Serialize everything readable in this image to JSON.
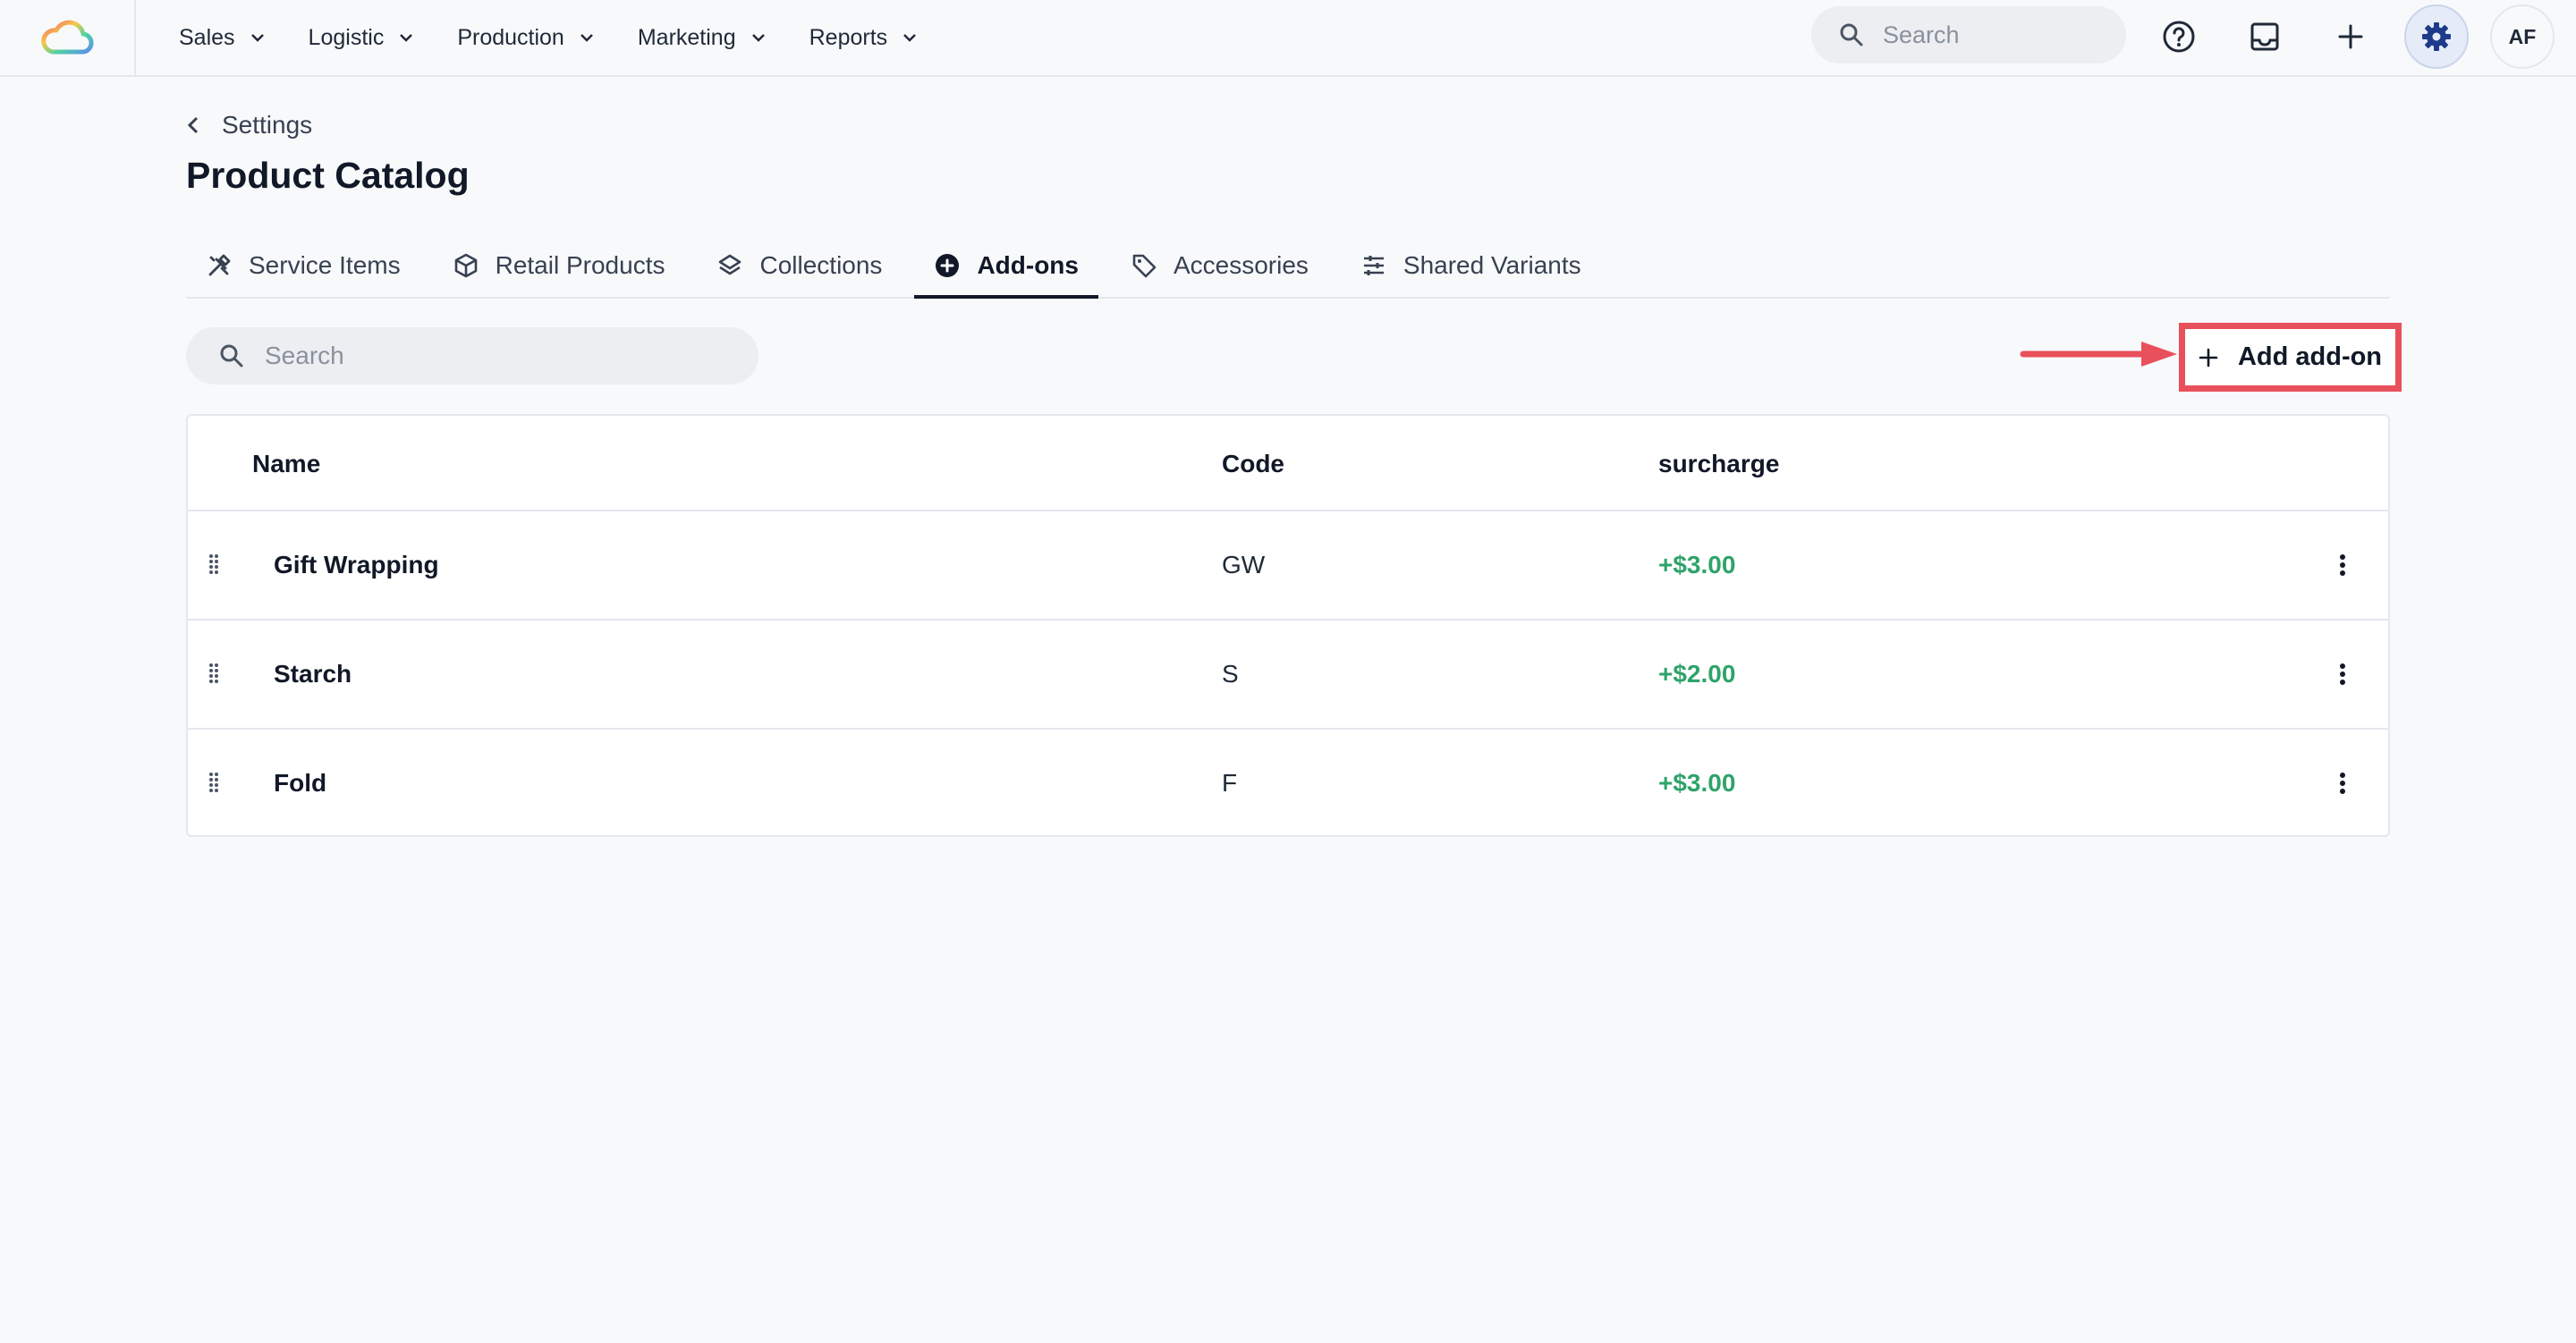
{
  "nav": {
    "items": [
      {
        "label": "Sales"
      },
      {
        "label": "Logistic"
      },
      {
        "label": "Production"
      },
      {
        "label": "Marketing"
      },
      {
        "label": "Reports"
      }
    ],
    "search_placeholder": "Search",
    "avatar_initials": "AF",
    "icons": [
      "cloud-logo-icon",
      "help-icon",
      "inbox-icon",
      "plus-icon",
      "gear-icon"
    ]
  },
  "header": {
    "breadcrumb": "Settings",
    "title": "Product Catalog"
  },
  "tabs": [
    {
      "label": "Service Items",
      "icon": "tools-icon"
    },
    {
      "label": "Retail Products",
      "icon": "box-icon"
    },
    {
      "label": "Collections",
      "icon": "layers-icon"
    },
    {
      "label": "Add-ons",
      "icon": "plus-circle-icon",
      "active": true
    },
    {
      "label": "Accessories",
      "icon": "tag-icon"
    },
    {
      "label": "Shared Variants",
      "icon": "sliders-icon"
    }
  ],
  "toolbar": {
    "search_placeholder": "Search",
    "add_label": "Add add-on"
  },
  "table": {
    "columns": [
      "Name",
      "Code",
      "surcharge"
    ],
    "rows": [
      {
        "name": "Gift Wrapping",
        "code": "GW",
        "surcharge": "+$3.00"
      },
      {
        "name": "Starch",
        "code": "S",
        "surcharge": "+$2.00"
      },
      {
        "name": "Fold",
        "code": "F",
        "surcharge": "+$3.00"
      }
    ]
  },
  "colors": {
    "accent": "#111827",
    "surcharge": "#2fa36b",
    "annotation": "#e8505b"
  }
}
